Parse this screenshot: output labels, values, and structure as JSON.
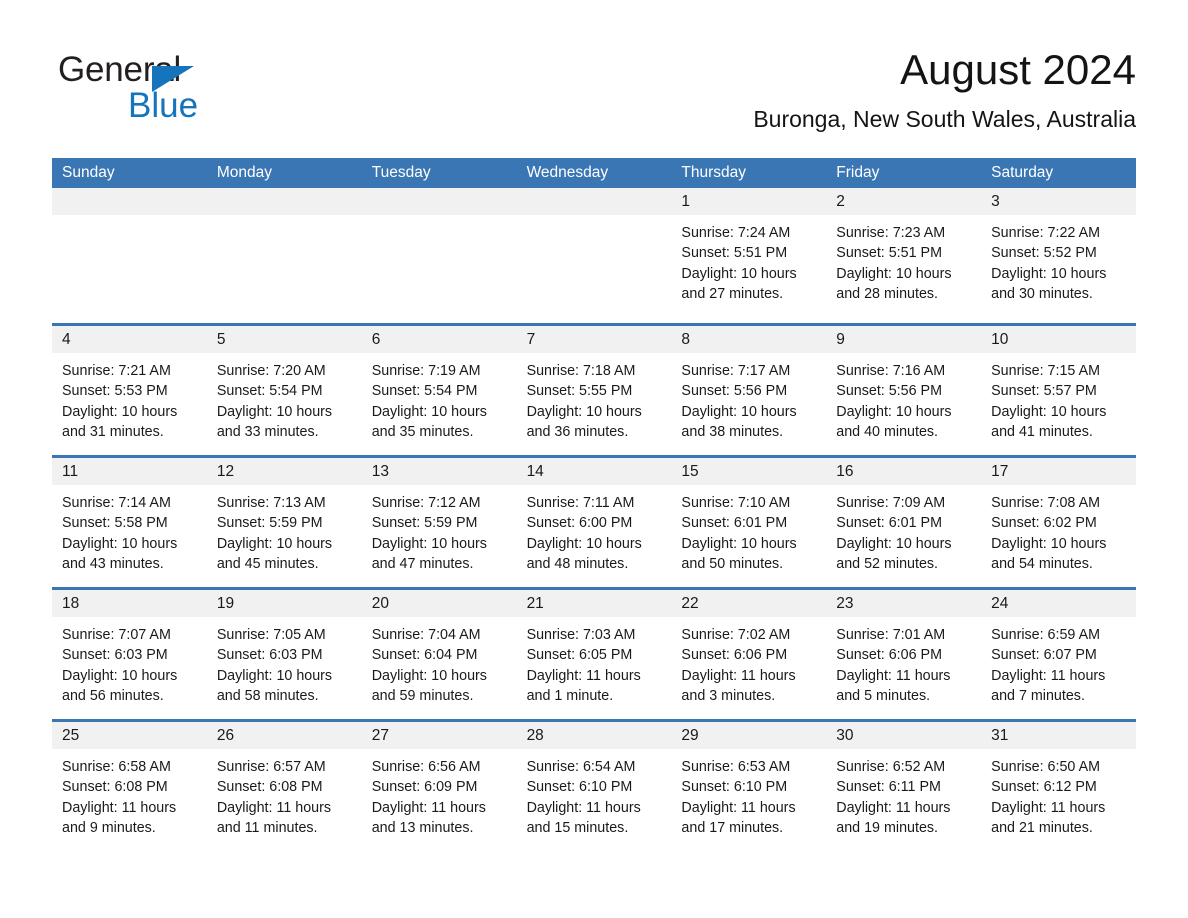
{
  "logo": {
    "word_one": "General",
    "word_two": "Blue",
    "triangle_icon": "triangle-icon",
    "blue": "#1574bb"
  },
  "header": {
    "title": "August 2024",
    "subtitle": "Buronga, New South Wales, Australia"
  },
  "theme": {
    "header_blue": "#3b76b4",
    "day_band_gray": "#f1f1f1",
    "text": "#1a1a1a"
  },
  "weekdays": [
    "Sunday",
    "Monday",
    "Tuesday",
    "Wednesday",
    "Thursday",
    "Friday",
    "Saturday"
  ],
  "weeks": [
    [
      {
        "date": "",
        "sunrise": "",
        "sunset": "",
        "daylight_1": "",
        "daylight_2": ""
      },
      {
        "date": "",
        "sunrise": "",
        "sunset": "",
        "daylight_1": "",
        "daylight_2": ""
      },
      {
        "date": "",
        "sunrise": "",
        "sunset": "",
        "daylight_1": "",
        "daylight_2": ""
      },
      {
        "date": "",
        "sunrise": "",
        "sunset": "",
        "daylight_1": "",
        "daylight_2": ""
      },
      {
        "date": "1",
        "sunrise": "Sunrise: 7:24 AM",
        "sunset": "Sunset: 5:51 PM",
        "daylight_1": "Daylight: 10 hours",
        "daylight_2": "and 27 minutes."
      },
      {
        "date": "2",
        "sunrise": "Sunrise: 7:23 AM",
        "sunset": "Sunset: 5:51 PM",
        "daylight_1": "Daylight: 10 hours",
        "daylight_2": "and 28 minutes."
      },
      {
        "date": "3",
        "sunrise": "Sunrise: 7:22 AM",
        "sunset": "Sunset: 5:52 PM",
        "daylight_1": "Daylight: 10 hours",
        "daylight_2": "and 30 minutes."
      }
    ],
    [
      {
        "date": "4",
        "sunrise": "Sunrise: 7:21 AM",
        "sunset": "Sunset: 5:53 PM",
        "daylight_1": "Daylight: 10 hours",
        "daylight_2": "and 31 minutes."
      },
      {
        "date": "5",
        "sunrise": "Sunrise: 7:20 AM",
        "sunset": "Sunset: 5:54 PM",
        "daylight_1": "Daylight: 10 hours",
        "daylight_2": "and 33 minutes."
      },
      {
        "date": "6",
        "sunrise": "Sunrise: 7:19 AM",
        "sunset": "Sunset: 5:54 PM",
        "daylight_1": "Daylight: 10 hours",
        "daylight_2": "and 35 minutes."
      },
      {
        "date": "7",
        "sunrise": "Sunrise: 7:18 AM",
        "sunset": "Sunset: 5:55 PM",
        "daylight_1": "Daylight: 10 hours",
        "daylight_2": "and 36 minutes."
      },
      {
        "date": "8",
        "sunrise": "Sunrise: 7:17 AM",
        "sunset": "Sunset: 5:56 PM",
        "daylight_1": "Daylight: 10 hours",
        "daylight_2": "and 38 minutes."
      },
      {
        "date": "9",
        "sunrise": "Sunrise: 7:16 AM",
        "sunset": "Sunset: 5:56 PM",
        "daylight_1": "Daylight: 10 hours",
        "daylight_2": "and 40 minutes."
      },
      {
        "date": "10",
        "sunrise": "Sunrise: 7:15 AM",
        "sunset": "Sunset: 5:57 PM",
        "daylight_1": "Daylight: 10 hours",
        "daylight_2": "and 41 minutes."
      }
    ],
    [
      {
        "date": "11",
        "sunrise": "Sunrise: 7:14 AM",
        "sunset": "Sunset: 5:58 PM",
        "daylight_1": "Daylight: 10 hours",
        "daylight_2": "and 43 minutes."
      },
      {
        "date": "12",
        "sunrise": "Sunrise: 7:13 AM",
        "sunset": "Sunset: 5:59 PM",
        "daylight_1": "Daylight: 10 hours",
        "daylight_2": "and 45 minutes."
      },
      {
        "date": "13",
        "sunrise": "Sunrise: 7:12 AM",
        "sunset": "Sunset: 5:59 PM",
        "daylight_1": "Daylight: 10 hours",
        "daylight_2": "and 47 minutes."
      },
      {
        "date": "14",
        "sunrise": "Sunrise: 7:11 AM",
        "sunset": "Sunset: 6:00 PM",
        "daylight_1": "Daylight: 10 hours",
        "daylight_2": "and 48 minutes."
      },
      {
        "date": "15",
        "sunrise": "Sunrise: 7:10 AM",
        "sunset": "Sunset: 6:01 PM",
        "daylight_1": "Daylight: 10 hours",
        "daylight_2": "and 50 minutes."
      },
      {
        "date": "16",
        "sunrise": "Sunrise: 7:09 AM",
        "sunset": "Sunset: 6:01 PM",
        "daylight_1": "Daylight: 10 hours",
        "daylight_2": "and 52 minutes."
      },
      {
        "date": "17",
        "sunrise": "Sunrise: 7:08 AM",
        "sunset": "Sunset: 6:02 PM",
        "daylight_1": "Daylight: 10 hours",
        "daylight_2": "and 54 minutes."
      }
    ],
    [
      {
        "date": "18",
        "sunrise": "Sunrise: 7:07 AM",
        "sunset": "Sunset: 6:03 PM",
        "daylight_1": "Daylight: 10 hours",
        "daylight_2": "and 56 minutes."
      },
      {
        "date": "19",
        "sunrise": "Sunrise: 7:05 AM",
        "sunset": "Sunset: 6:03 PM",
        "daylight_1": "Daylight: 10 hours",
        "daylight_2": "and 58 minutes."
      },
      {
        "date": "20",
        "sunrise": "Sunrise: 7:04 AM",
        "sunset": "Sunset: 6:04 PM",
        "daylight_1": "Daylight: 10 hours",
        "daylight_2": "and 59 minutes."
      },
      {
        "date": "21",
        "sunrise": "Sunrise: 7:03 AM",
        "sunset": "Sunset: 6:05 PM",
        "daylight_1": "Daylight: 11 hours",
        "daylight_2": "and 1 minute."
      },
      {
        "date": "22",
        "sunrise": "Sunrise: 7:02 AM",
        "sunset": "Sunset: 6:06 PM",
        "daylight_1": "Daylight: 11 hours",
        "daylight_2": "and 3 minutes."
      },
      {
        "date": "23",
        "sunrise": "Sunrise: 7:01 AM",
        "sunset": "Sunset: 6:06 PM",
        "daylight_1": "Daylight: 11 hours",
        "daylight_2": "and 5 minutes."
      },
      {
        "date": "24",
        "sunrise": "Sunrise: 6:59 AM",
        "sunset": "Sunset: 6:07 PM",
        "daylight_1": "Daylight: 11 hours",
        "daylight_2": "and 7 minutes."
      }
    ],
    [
      {
        "date": "25",
        "sunrise": "Sunrise: 6:58 AM",
        "sunset": "Sunset: 6:08 PM",
        "daylight_1": "Daylight: 11 hours",
        "daylight_2": "and 9 minutes."
      },
      {
        "date": "26",
        "sunrise": "Sunrise: 6:57 AM",
        "sunset": "Sunset: 6:08 PM",
        "daylight_1": "Daylight: 11 hours",
        "daylight_2": "and 11 minutes."
      },
      {
        "date": "27",
        "sunrise": "Sunrise: 6:56 AM",
        "sunset": "Sunset: 6:09 PM",
        "daylight_1": "Daylight: 11 hours",
        "daylight_2": "and 13 minutes."
      },
      {
        "date": "28",
        "sunrise": "Sunrise: 6:54 AM",
        "sunset": "Sunset: 6:10 PM",
        "daylight_1": "Daylight: 11 hours",
        "daylight_2": "and 15 minutes."
      },
      {
        "date": "29",
        "sunrise": "Sunrise: 6:53 AM",
        "sunset": "Sunset: 6:10 PM",
        "daylight_1": "Daylight: 11 hours",
        "daylight_2": "and 17 minutes."
      },
      {
        "date": "30",
        "sunrise": "Sunrise: 6:52 AM",
        "sunset": "Sunset: 6:11 PM",
        "daylight_1": "Daylight: 11 hours",
        "daylight_2": "and 19 minutes."
      },
      {
        "date": "31",
        "sunrise": "Sunrise: 6:50 AM",
        "sunset": "Sunset: 6:12 PM",
        "daylight_1": "Daylight: 11 hours",
        "daylight_2": "and 21 minutes."
      }
    ]
  ]
}
